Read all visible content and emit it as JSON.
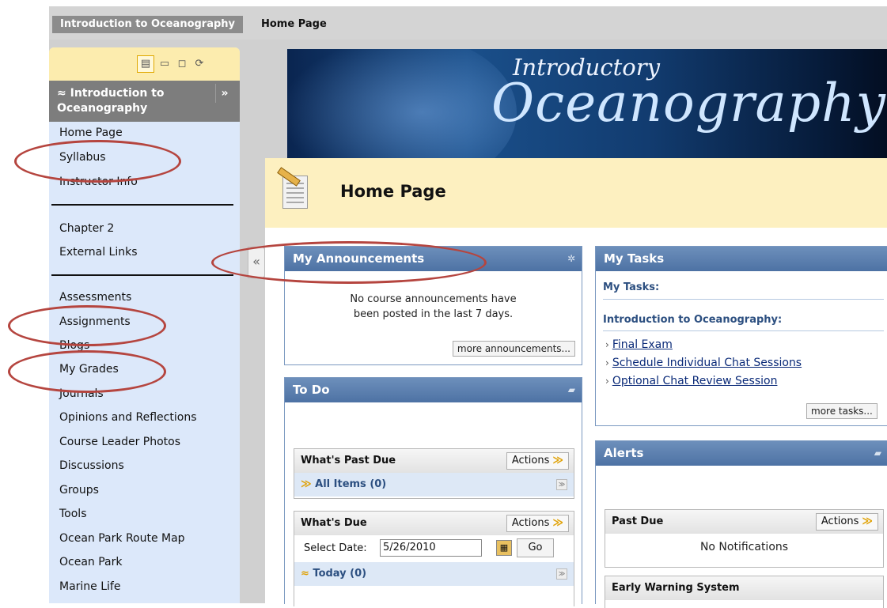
{
  "breadcrumb": {
    "course": "Introduction to Oceanography",
    "page": "Home Page"
  },
  "menu": {
    "toolbar": [
      "list-view-icon",
      "folder-view-icon",
      "new-window-icon",
      "refresh-icon"
    ],
    "title": "Introduction to Oceanography",
    "collapse": "»",
    "expand_arrow": "«",
    "items": [
      "Home Page",
      "Syllabus",
      "Instructor Info",
      "Chapter 2",
      "External Links",
      "Assessments",
      "Assignments",
      "Blogs",
      "My Grades",
      "Journals",
      "Opinions and Reflections",
      "Course Leader Photos",
      "Discussions",
      "Groups",
      "Tools",
      "Ocean Park Route Map",
      "Ocean Park",
      "Marine Life"
    ]
  },
  "banner": {
    "line1": "Introductory",
    "line2": "Oceanography"
  },
  "page": {
    "title": "Home Page"
  },
  "announcements": {
    "header": "My Announcements",
    "text1": "No course announcements have",
    "text2": "been posted in the last 7 days.",
    "more": "more announcements..."
  },
  "tasks": {
    "header": "My Tasks",
    "subhead": "My Tasks:",
    "course": "Introduction to Oceanography:",
    "items": [
      "Final Exam",
      "Schedule Individual Chat Sessions",
      "Optional Chat Review Session"
    ],
    "more": "more tasks..."
  },
  "todo": {
    "header": "To Do",
    "past_due": "What's Past Due",
    "actions": "Actions",
    "all_items": "All Items (0)",
    "whats_due": "What's Due",
    "select_date_label": "Select Date:",
    "date_value": "5/26/2010",
    "go": "Go",
    "today": "Today (0)"
  },
  "alerts": {
    "header": "Alerts",
    "past_due": "Past Due",
    "actions": "Actions",
    "no_notifications": "No Notifications",
    "early_warning": "Early Warning System"
  },
  "colors": {
    "annotation": "#b5453f",
    "module_header": "#4d72a4",
    "menu_bg": "#dce8fa"
  }
}
